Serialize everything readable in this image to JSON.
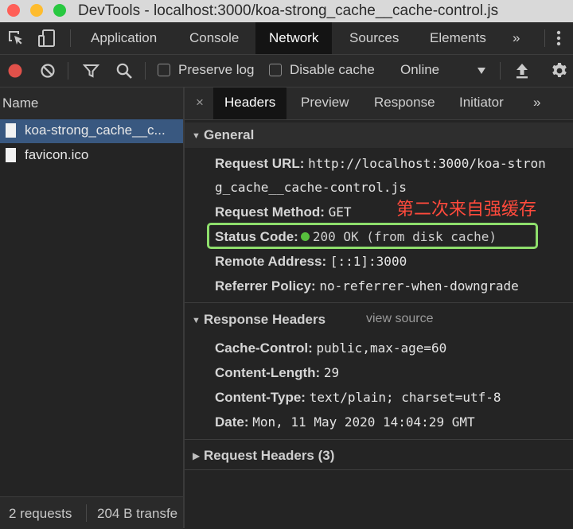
{
  "window": {
    "title": "DevTools - localhost:3000/koa-strong_cache__cache-control.js"
  },
  "main_tabs": {
    "items": [
      "Application",
      "Console",
      "Network",
      "Sources",
      "Elements"
    ],
    "active": "Network",
    "more": "»"
  },
  "toolbar": {
    "preserve_log": "Preserve log",
    "disable_cache": "Disable cache",
    "throttling": "Online"
  },
  "requests": {
    "header": "Name",
    "files": [
      "koa-strong_cache__c...",
      "favicon.ico"
    ],
    "selected_index": 0,
    "summary": "2 requests",
    "transfer": "204 B transfe"
  },
  "detail_tabs": {
    "close": "×",
    "items": [
      "Headers",
      "Preview",
      "Response",
      "Initiator"
    ],
    "active": "Headers",
    "more": "»"
  },
  "general": {
    "title": "General",
    "request_url_key": "Request URL:",
    "request_url_value_1": "http://localhost:3000/koa-stron",
    "request_url_value_2": "g_cache__cache-control.js",
    "request_method_key": "Request Method:",
    "request_method_value": "GET",
    "status_code_key": "Status Code:",
    "status_code_value": "200 OK (from disk cache)",
    "remote_address_key": "Remote Address:",
    "remote_address_value": "[::1]:3000",
    "referrer_policy_key": "Referrer Policy:",
    "referrer_policy_value": "no-referrer-when-downgrade"
  },
  "annotation": "第二次来自强缓存",
  "response_headers": {
    "title": "Response Headers",
    "view_source": "view source",
    "cache_control_key": "Cache-Control:",
    "cache_control_value": "public,max-age=60",
    "content_length_key": "Content-Length:",
    "content_length_value": "29",
    "content_type_key": "Content-Type:",
    "content_type_value": "text/plain; charset=utf-8",
    "date_key": "Date:",
    "date_value": "Mon, 11 May 2020 14:04:29 GMT"
  },
  "request_headers": {
    "title": "Request Headers (3)"
  },
  "colors": {
    "accent_selected_row": "#395880",
    "status_dot": "#57c03d",
    "highlight_box": "#8ede6c",
    "annotation": "#ff4a3c",
    "record_button": "#e0514a"
  },
  "icons": [
    "inspect-element-icon",
    "device-toolbar-icon",
    "more-vert-icon",
    "record-icon",
    "clear-icon",
    "filter-icon",
    "search-icon",
    "dropdown-arrow-icon",
    "import-har-icon",
    "settings-icon",
    "file-icon"
  ]
}
